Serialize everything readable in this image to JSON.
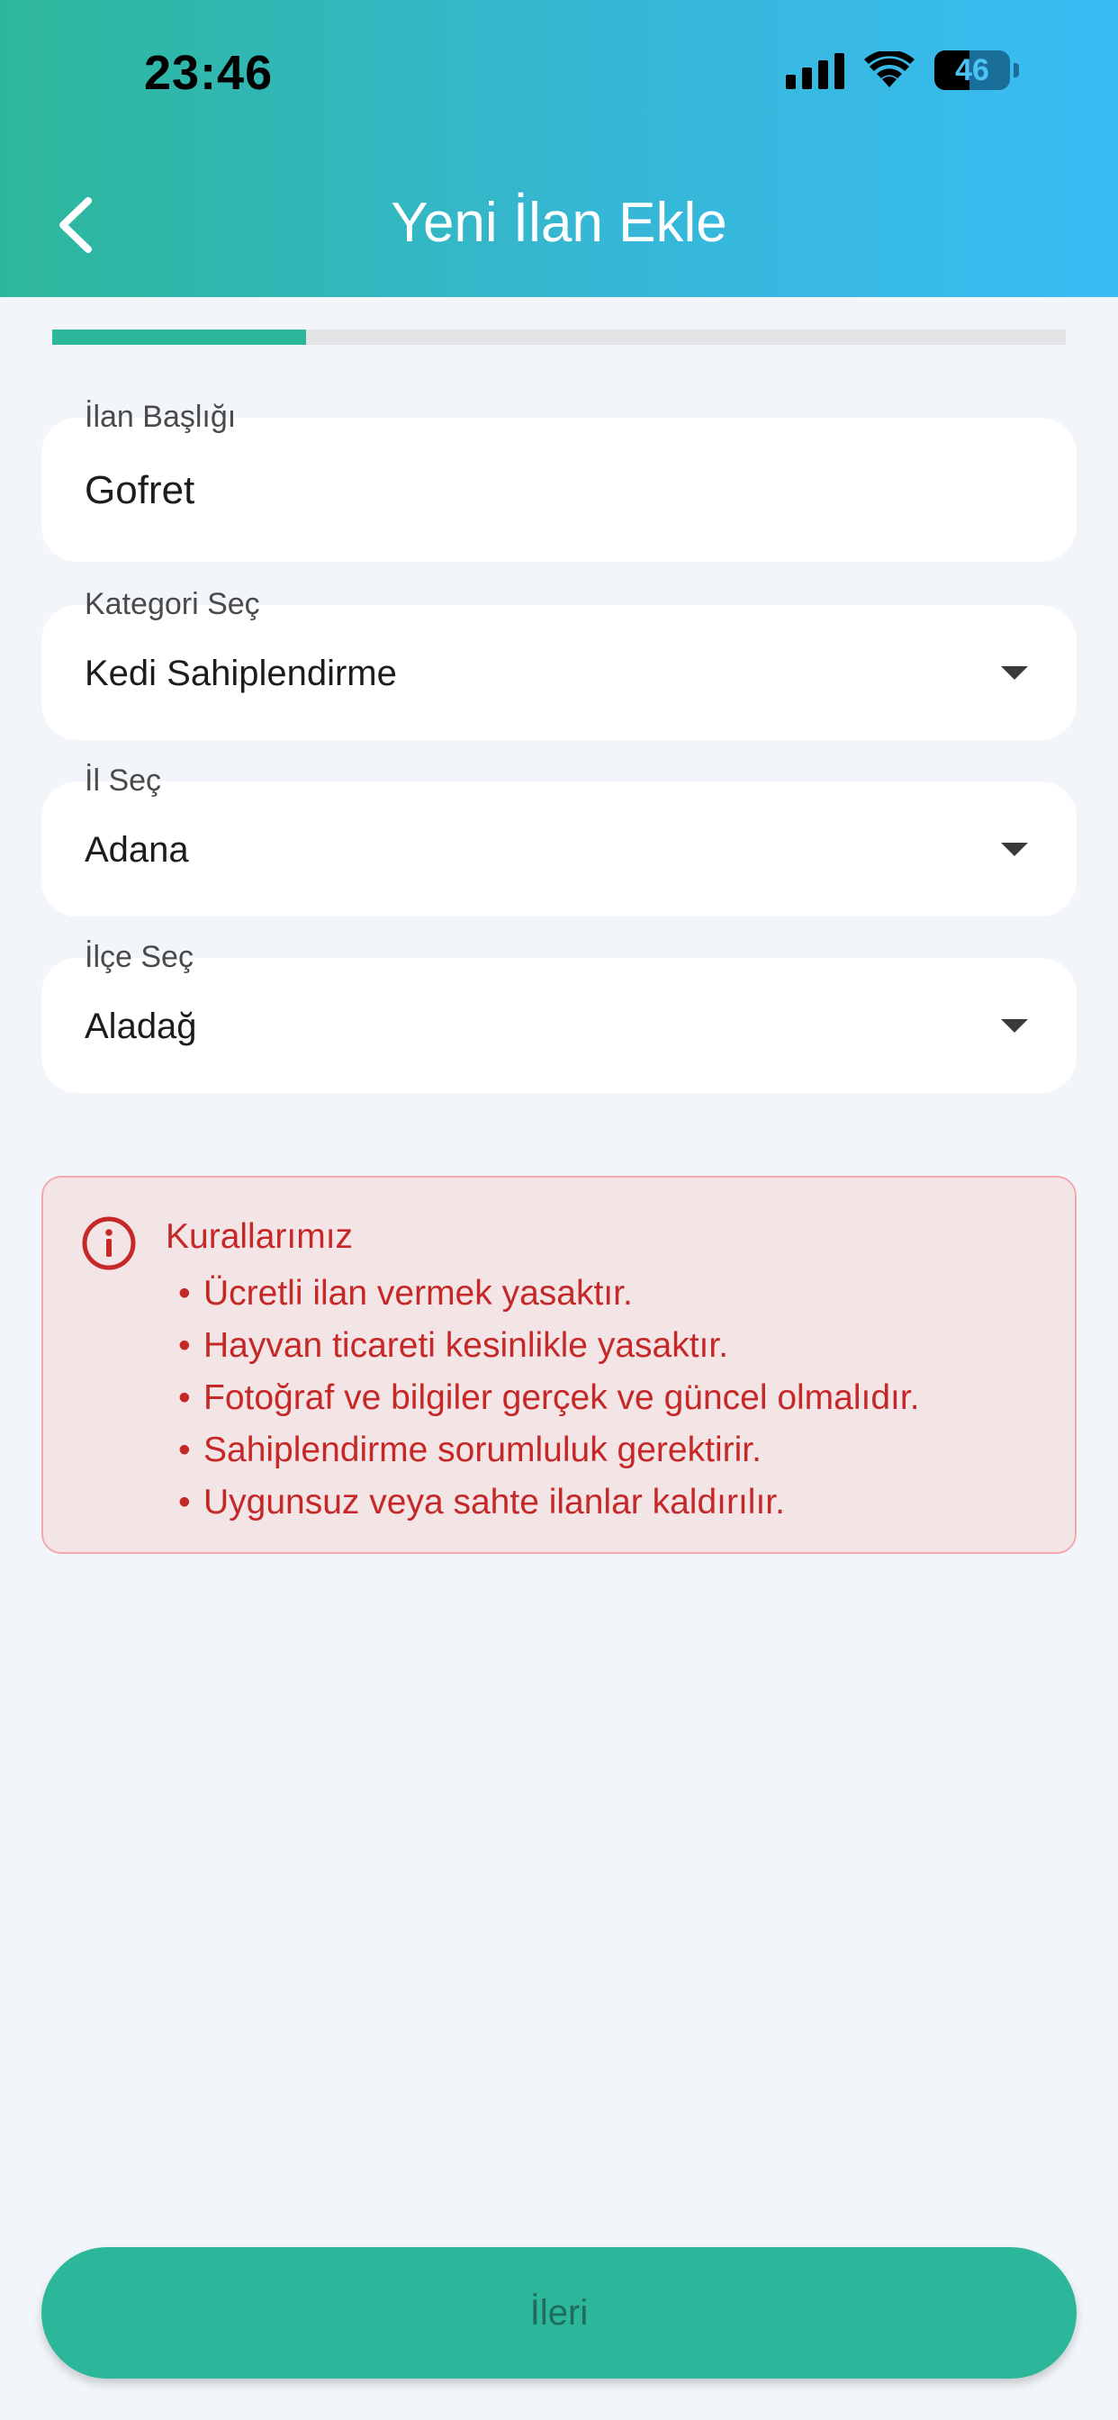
{
  "status_bar": {
    "time": "23:46",
    "battery_percent": "46",
    "icons": [
      "signal-icon",
      "wifi-icon",
      "battery-icon"
    ]
  },
  "header": {
    "title": "Yeni İlan Ekle",
    "back_icon": "chevron-left-icon"
  },
  "progress": {
    "fraction": 0.25
  },
  "form": {
    "title_field": {
      "label": "İlan Başlığı",
      "value": "Gofret"
    },
    "category_select": {
      "label": "Kategori Seç",
      "value": "Kedi Sahiplendirme"
    },
    "city_select": {
      "label": "İl Seç",
      "value": "Adana"
    },
    "district_select": {
      "label": "İlçe Seç",
      "value": "Aladağ"
    }
  },
  "rules": {
    "icon": "info-icon",
    "title": "Kurallarımız",
    "items": [
      "Ücretli ilan vermek yasaktır.",
      "Hayvan ticareti kesinlikle yasaktır.",
      "Fotoğraf ve bilgiler gerçek ve güncel olmalıdır.",
      "Sahiplendirme sorumluluk gerektirir.",
      "Uygunsuz veya sahte ilanlar kaldırılır."
    ]
  },
  "footer": {
    "next_label": "İleri"
  },
  "colors": {
    "accent": "#2db79a",
    "header_gradient_end": "#39bcf4",
    "warning_text": "#c62828",
    "warning_bg": "#f3e4e6",
    "page_bg": "#f2f6fa"
  }
}
